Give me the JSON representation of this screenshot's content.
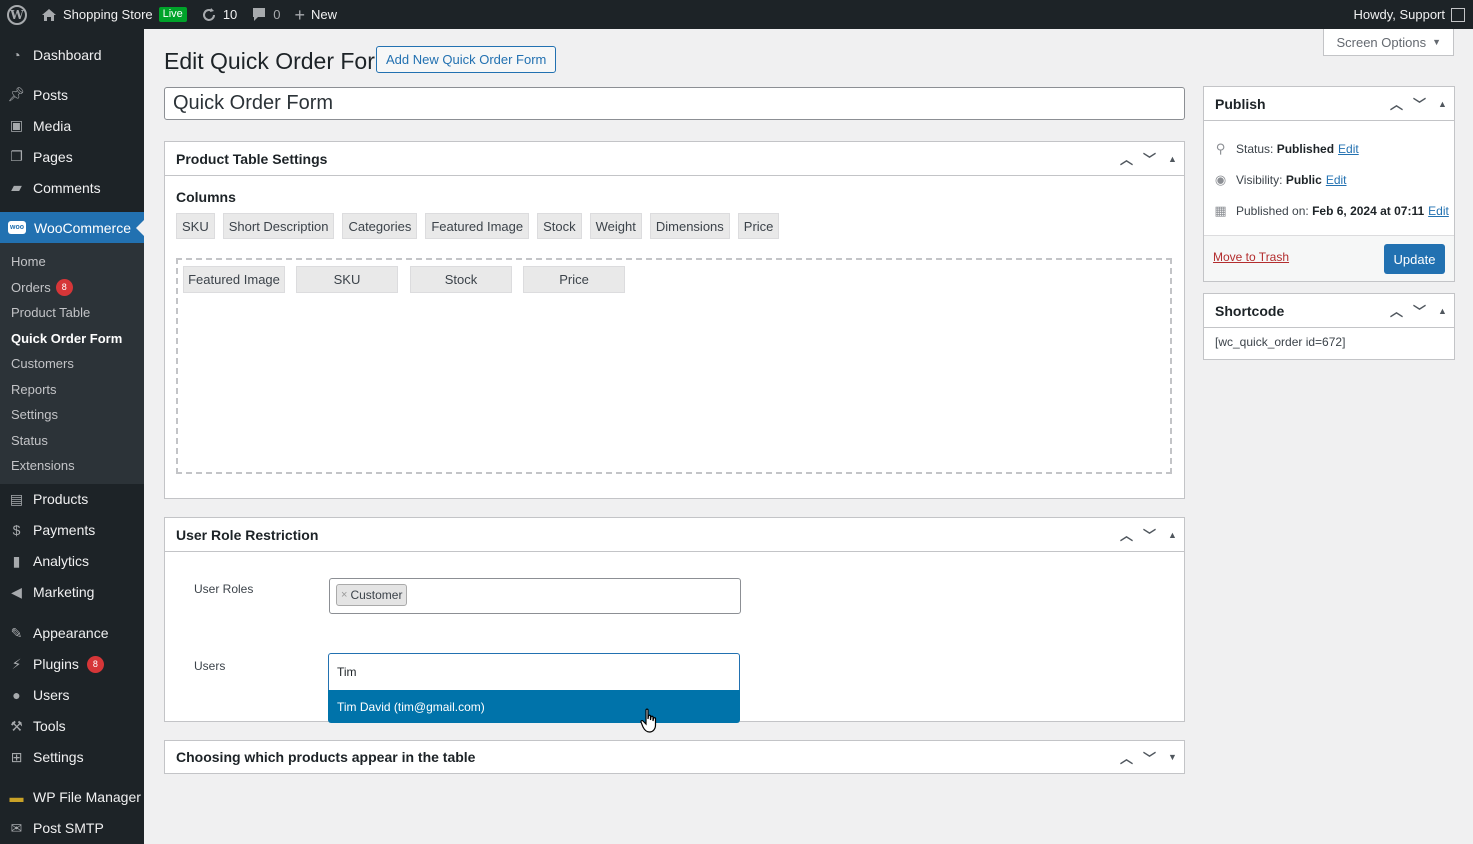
{
  "adminbar": {
    "site_name": "Shopping Store",
    "live_badge": "Live",
    "updates_count": "10",
    "comments_count": "0",
    "new_label": "New",
    "howdy": "Howdy, Support"
  },
  "sidebar": {
    "dashboard": "Dashboard",
    "posts": "Posts",
    "media": "Media",
    "pages": "Pages",
    "comments": "Comments",
    "woocommerce": "WooCommerce",
    "woo_icon_text": "woo",
    "sub": {
      "home": "Home",
      "orders": "Orders",
      "orders_count": "8",
      "product_table": "Product Table",
      "quick_order_form": "Quick Order Form",
      "customers": "Customers",
      "reports": "Reports",
      "settings": "Settings",
      "status": "Status",
      "extensions": "Extensions"
    },
    "products": "Products",
    "payments": "Payments",
    "analytics": "Analytics",
    "marketing": "Marketing",
    "appearance": "Appearance",
    "plugins": "Plugins",
    "plugins_count": "8",
    "users": "Users",
    "tools": "Tools",
    "settings": "Settings",
    "wp_file_manager": "WP File Manager",
    "post_smtp": "Post SMTP"
  },
  "main": {
    "screen_options": "Screen Options",
    "page_title": "Edit Quick Order Form",
    "add_new": "Add New Quick Order Form",
    "post_title": "Quick Order Form",
    "product_table_settings": {
      "title": "Product Table Settings",
      "columns_label": "Columns",
      "available_columns": [
        "SKU",
        "Short Description",
        "Categories",
        "Featured Image",
        "Stock",
        "Weight",
        "Dimensions",
        "Price"
      ],
      "selected_columns": [
        "Featured Image",
        "SKU",
        "Stock",
        "Price"
      ]
    },
    "user_role_restriction": {
      "title": "User Role Restriction",
      "user_roles_label": "User Roles",
      "selected_role": "Customer",
      "token_remove": "×",
      "users_label": "Users",
      "users_search": "Tim",
      "search_result": "Tim David (tim@gmail.com)"
    },
    "choosing_products": {
      "title": "Choosing which products appear in the table"
    }
  },
  "publish": {
    "title": "Publish",
    "status_label": "Status:",
    "status_value": "Published",
    "visibility_label": "Visibility:",
    "visibility_value": "Public",
    "published_on_label": "Published on:",
    "published_on_value": "Feb 6, 2024 at 07:11",
    "edit": "Edit",
    "move_to_trash": "Move to Trash",
    "update": "Update"
  },
  "shortcode": {
    "title": "Shortcode",
    "value": "[wc_quick_order id=672]"
  }
}
